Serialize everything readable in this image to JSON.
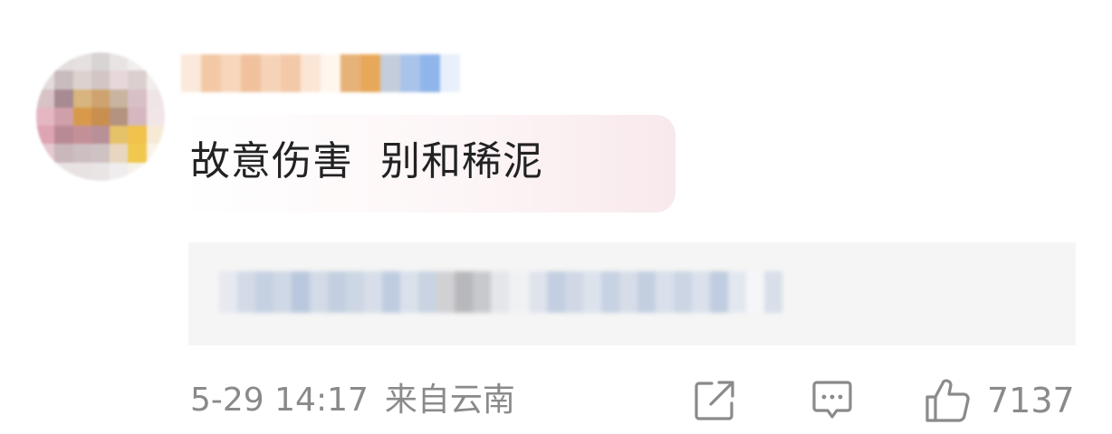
{
  "comment": {
    "text": "故意伤害  别和稀泥",
    "date": "5-29",
    "time": "14:17",
    "location": "来自云南",
    "like_count": "7137"
  },
  "icons": {
    "share": "share-icon",
    "reply": "comment-icon",
    "like": "thumbs-up-icon"
  },
  "colors": {
    "meta_text": "#8a8a8a",
    "comment_text": "#222222",
    "reply_bg": "#f5f5f5"
  }
}
